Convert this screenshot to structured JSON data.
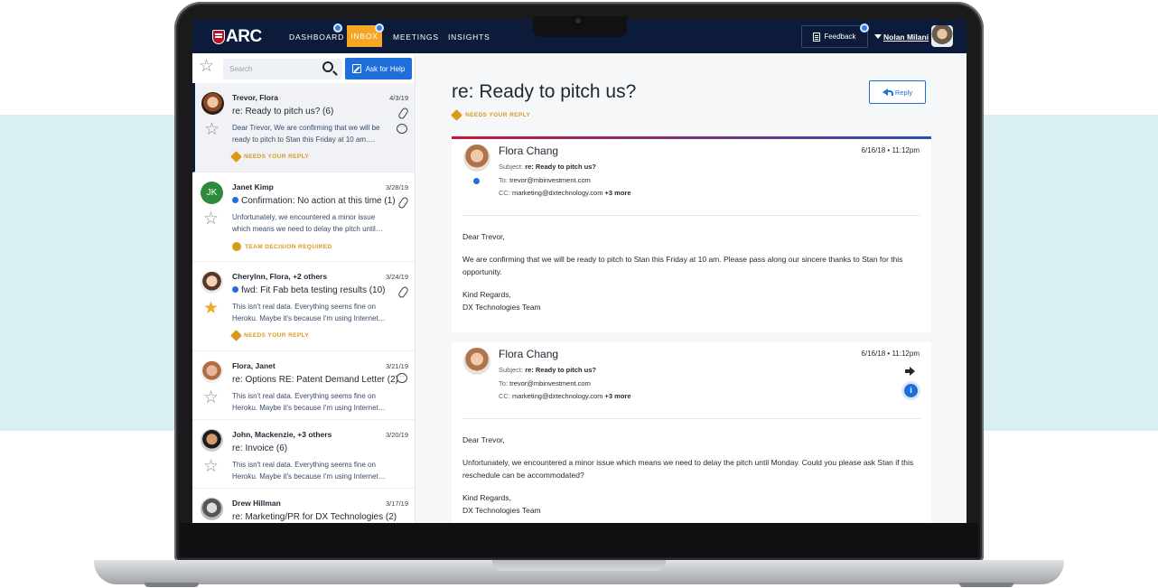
{
  "nav": {
    "logo": "ARC",
    "items": [
      "DASHBOARD",
      "INBOX",
      "MEETINGS",
      "INSIGHTS"
    ],
    "feedback": "Feedback",
    "user": "Nolan Milani"
  },
  "toolbar": {
    "search_placeholder": "Search",
    "ask_label": "Ask for Help"
  },
  "threads": [
    {
      "who": "Trevor, Flora",
      "date": "4/3/19",
      "subject": "re: Ready to pitch us? (6)",
      "preview": "Dear Trevor, We are confirming that we will be ready to pitch to Stan this Friday at 10 am.…",
      "tag": "NEEDS YOUR REPLY"
    },
    {
      "who": "Janet Kimp",
      "initials": "JK",
      "date": "3/28/19",
      "subject": "Confirmation: No action at this time (1)",
      "preview": "Unfortunately, we encountered a minor issue which means we need to delay the pitch until…",
      "tag": "TEAM DECISION REQUIRED"
    },
    {
      "who": "Cherylnn, Flora, +2 others",
      "date": "3/24/19",
      "subject": "fwd: Fit Fab beta testing results (10)",
      "preview": "This isn't real data. Everything seems fine on Heroku. Maybe it's because I'm using Internet…",
      "tag": "NEEDS YOUR REPLY"
    },
    {
      "who": "Flora, Janet",
      "date": "3/21/19",
      "subject": "re: Options RE: Patent Demand Letter (2)",
      "preview": "This isn't real data. Everything seems fine on Heroku. Maybe it's because I'm using Internet…"
    },
    {
      "who": "John, Mackenzie, +3 others",
      "date": "3/20/19",
      "subject": "re: Invoice (6)",
      "preview": "This isn't real data. Everything seems fine on Heroku. Maybe it's because I'm using Internet…"
    },
    {
      "who": "Drew Hillman",
      "date": "3/17/19",
      "subject": "re: Marketing/PR for DX Technologies (2)"
    }
  ],
  "detail": {
    "title": "re: Ready to pitch us?",
    "status": "NEEDS YOUR REPLY",
    "reply_label": "Reply",
    "messages": [
      {
        "from": "Flora Chang",
        "date": "6/16/18 • 11:12pm",
        "subject_label": "Subject:",
        "subject": "re: Ready to pitch us?",
        "to_label": "To:",
        "to": "trevor@mbinvestment.com",
        "cc_label": "CC:",
        "cc": "marketing@dxtechnology.com",
        "cc_more": "+3 more",
        "body": [
          "Dear Trevor,",
          "We are confirming that we will be ready to pitch to Stan this Friday at 10 am. Please pass along our sincere thanks to Stan for this opportunity.",
          "Kind Regards,",
          "DX Technologies Team"
        ]
      },
      {
        "from": "Flora Chang",
        "date": "6/16/18 • 11:12pm",
        "subject_label": "Subject:",
        "subject": "re: Ready to pitch us?",
        "to_label": "To:",
        "to": "trevor@mbinvestment.com",
        "cc_label": "CC:",
        "cc": "marketing@dxtechnology.com",
        "cc_more": "+3 more",
        "body": [
          "Dear Trevor,",
          " Unfortunately, we encountered a minor issue which means we need to delay the pitch until Monday. Could you please ask Stan if this reschedule can be accommodated?",
          "Kind Regards,",
          "DX Technologies Team"
        ]
      }
    ]
  },
  "colors": {
    "nav_bg": "#0c1b3a",
    "accent": "#1e6fd9",
    "inbox_active": "#f5a623",
    "warning": "#d99a1b"
  }
}
